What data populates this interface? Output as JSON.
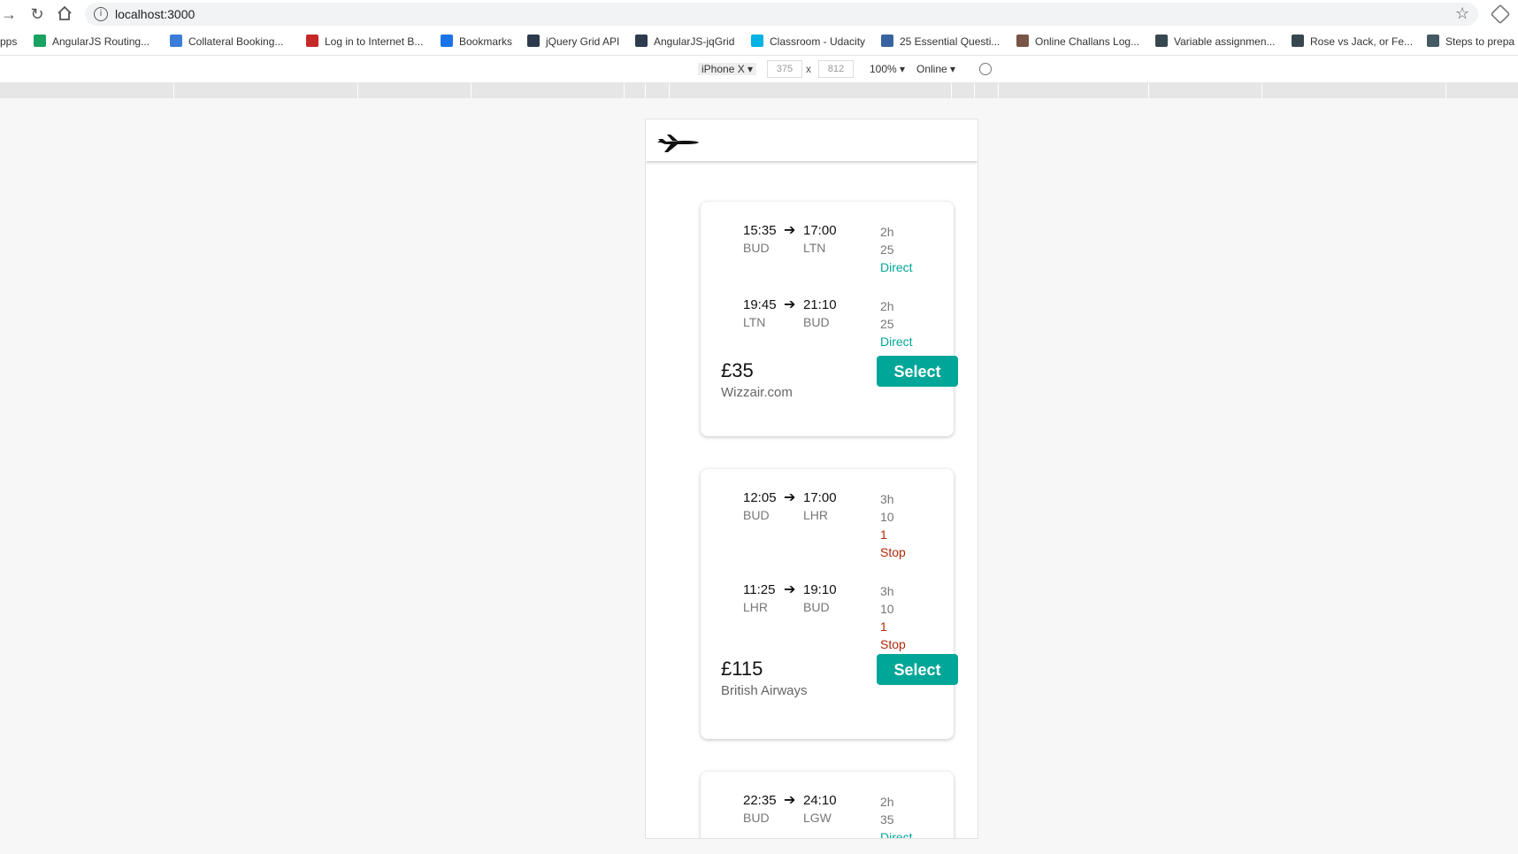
{
  "browser": {
    "url": "localhost:3000",
    "info_glyph": "i",
    "star_glyph": "☆"
  },
  "bookmarks": [
    {
      "label": "pps",
      "icon": "apps-icon",
      "color": "#4285f4"
    },
    {
      "label": "AngularJS Routing...",
      "icon": "vp-icon",
      "color": "#1aa260"
    },
    {
      "label": "Collateral Booking...",
      "icon": "collateral-icon",
      "color": "#3b7dd8"
    },
    {
      "label": "Log in to Internet B...",
      "icon": "bank-icon",
      "color": "#c62828"
    },
    {
      "label": "Bookmarks",
      "icon": "star-icon",
      "color": "#1a73e8"
    },
    {
      "label": "jQuery Grid API",
      "icon": "jquery-icon",
      "color": "#2e3a4d"
    },
    {
      "label": "AngularJS-jqGrid",
      "icon": "jqgrid-icon",
      "color": "#2e3a4d"
    },
    {
      "label": "Classroom - Udacity",
      "icon": "udacity-icon",
      "color": "#02b3e4"
    },
    {
      "label": "25 Essential Questi...",
      "icon": "toptal-icon",
      "color": "#3863a0"
    },
    {
      "label": "Online Challans Log...",
      "icon": "challan-icon",
      "color": "#795548"
    },
    {
      "label": "Variable assignmen...",
      "icon": "shield-icon",
      "color": "#37474f"
    },
    {
      "label": "Rose vs Jack, or Fe...",
      "icon": "shield-icon",
      "color": "#37474f"
    },
    {
      "label": "Steps to prepa",
      "icon": "globe-icon",
      "color": "#455a64"
    }
  ],
  "devtools": {
    "device": "iPhone X ▾",
    "width": "375",
    "height": "812",
    "times": "x",
    "zoom": "100% ▾",
    "network": "Online ▾"
  },
  "flights": [
    {
      "legs": [
        {
          "dep_time": "15:35",
          "arr_time": "17:00",
          "dep_code": "BUD",
          "arr_code": "LTN",
          "dur_h": "2h",
          "dur_m": "25",
          "stops": [
            "Direct"
          ],
          "direct": true
        },
        {
          "dep_time": "19:45",
          "arr_time": "21:10",
          "dep_code": "LTN",
          "arr_code": "BUD",
          "dur_h": "2h",
          "dur_m": "25",
          "stops": [
            "Direct"
          ],
          "direct": true
        }
      ],
      "price": "£35",
      "airline": "Wizzair.com",
      "select_label": "Select"
    },
    {
      "legs": [
        {
          "dep_time": "12:05",
          "arr_time": "17:00",
          "dep_code": "BUD",
          "arr_code": "LHR",
          "dur_h": "3h",
          "dur_m": "10",
          "stops": [
            "1",
            "Stop"
          ],
          "direct": false
        },
        {
          "dep_time": "11:25",
          "arr_time": "19:10",
          "dep_code": "LHR",
          "arr_code": "BUD",
          "dur_h": "3h",
          "dur_m": "10",
          "stops": [
            "1",
            "Stop"
          ],
          "direct": false
        }
      ],
      "price": "£115",
      "airline": "British Airways",
      "select_label": "Select"
    },
    {
      "legs": [
        {
          "dep_time": "22:35",
          "arr_time": "24:10",
          "dep_code": "BUD",
          "arr_code": "LGW",
          "dur_h": "2h",
          "dur_m": "35",
          "stops": [
            "Direct"
          ],
          "direct": true
        }
      ],
      "price": "",
      "airline": "",
      "select_label": ""
    }
  ],
  "colors": {
    "accent": "#00a698",
    "stop": "#b12704"
  }
}
